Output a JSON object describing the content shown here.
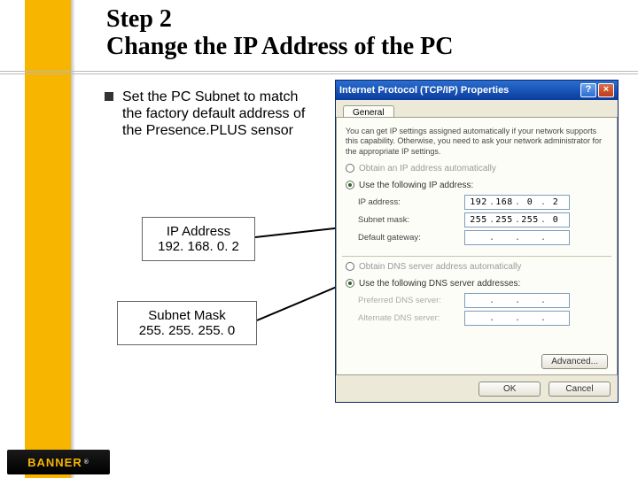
{
  "title": {
    "line1": "Step 2",
    "line2": "Change the IP Address of the PC"
  },
  "bullet": {
    "text": "Set the PC Subnet to match the factory default address of the Presence.PLUS sensor"
  },
  "callouts": {
    "ip": {
      "label": "IP Address",
      "value": "192. 168. 0. 2"
    },
    "mask": {
      "label": "Subnet Mask",
      "value": "255. 255. 255. 0"
    }
  },
  "dialog": {
    "title": "Internet Protocol (TCP/IP) Properties",
    "help_btn": "?",
    "close_btn": "×",
    "tab": "General",
    "desc": "You can get IP settings assigned automatically if your network supports this capability. Otherwise, you need to ask your network administrator for the appropriate IP settings.",
    "radio_auto_ip": "Obtain an IP address automatically",
    "radio_use_ip": "Use the following IP address:",
    "fields": {
      "ip_label": "IP address:",
      "ip_octets": [
        "192",
        "168",
        "0",
        "2"
      ],
      "mask_label": "Subnet mask:",
      "mask_octets": [
        "255",
        "255",
        "255",
        "0"
      ],
      "gw_label": "Default gateway:",
      "gw_octets": [
        "",
        "",
        "",
        ""
      ]
    },
    "radio_auto_dns": "Obtain DNS server address automatically",
    "radio_use_dns": "Use the following DNS server addresses:",
    "dns": {
      "pref_label": "Preferred DNS server:",
      "pref_octets": [
        "",
        "",
        "",
        ""
      ],
      "alt_label": "Alternate DNS server:",
      "alt_octets": [
        "",
        "",
        "",
        ""
      ]
    },
    "advanced_btn": "Advanced...",
    "ok_btn": "OK",
    "cancel_btn": "Cancel"
  },
  "footer": {
    "brand": "BANNER",
    "tm": "®"
  }
}
